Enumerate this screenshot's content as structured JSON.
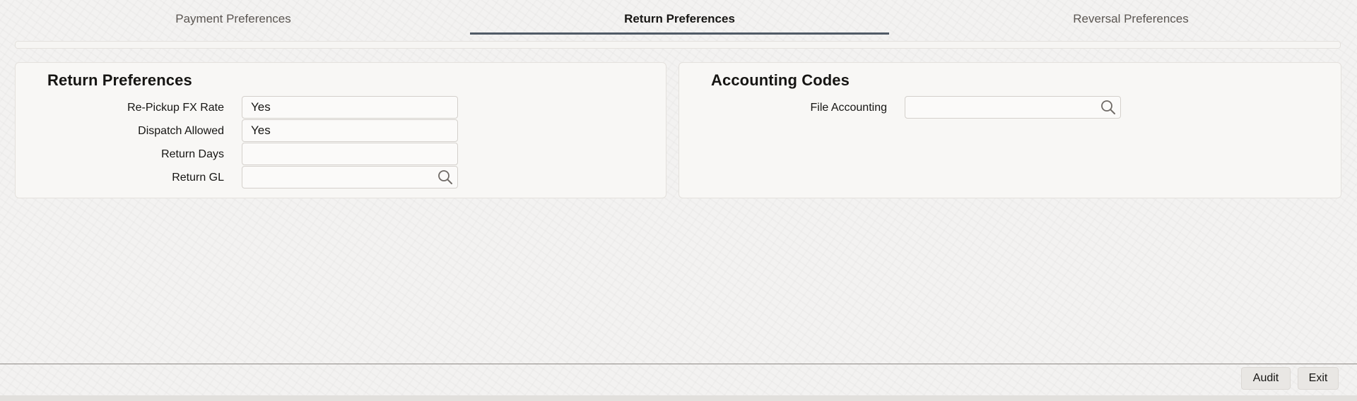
{
  "tabs": [
    {
      "label": "Payment Preferences",
      "active": false
    },
    {
      "label": "Return Preferences",
      "active": true
    },
    {
      "label": "Reversal Preferences",
      "active": false
    }
  ],
  "return_preferences": {
    "title": "Return Preferences",
    "fields": {
      "repickup_fx_rate": {
        "label": "Re-Pickup FX Rate",
        "value": "Yes"
      },
      "dispatch_allowed": {
        "label": "Dispatch Allowed",
        "value": "Yes"
      },
      "return_days": {
        "label": "Return Days",
        "value": ""
      },
      "return_gl": {
        "label": "Return GL",
        "value": ""
      }
    }
  },
  "accounting_codes": {
    "title": "Accounting Codes",
    "fields": {
      "file_accounting": {
        "label": "File Accounting",
        "value": ""
      }
    }
  },
  "footer": {
    "audit_label": "Audit",
    "exit_label": "Exit"
  },
  "colors": {
    "active_tab_underline": "#505a66",
    "background": "#f3f2f1"
  }
}
